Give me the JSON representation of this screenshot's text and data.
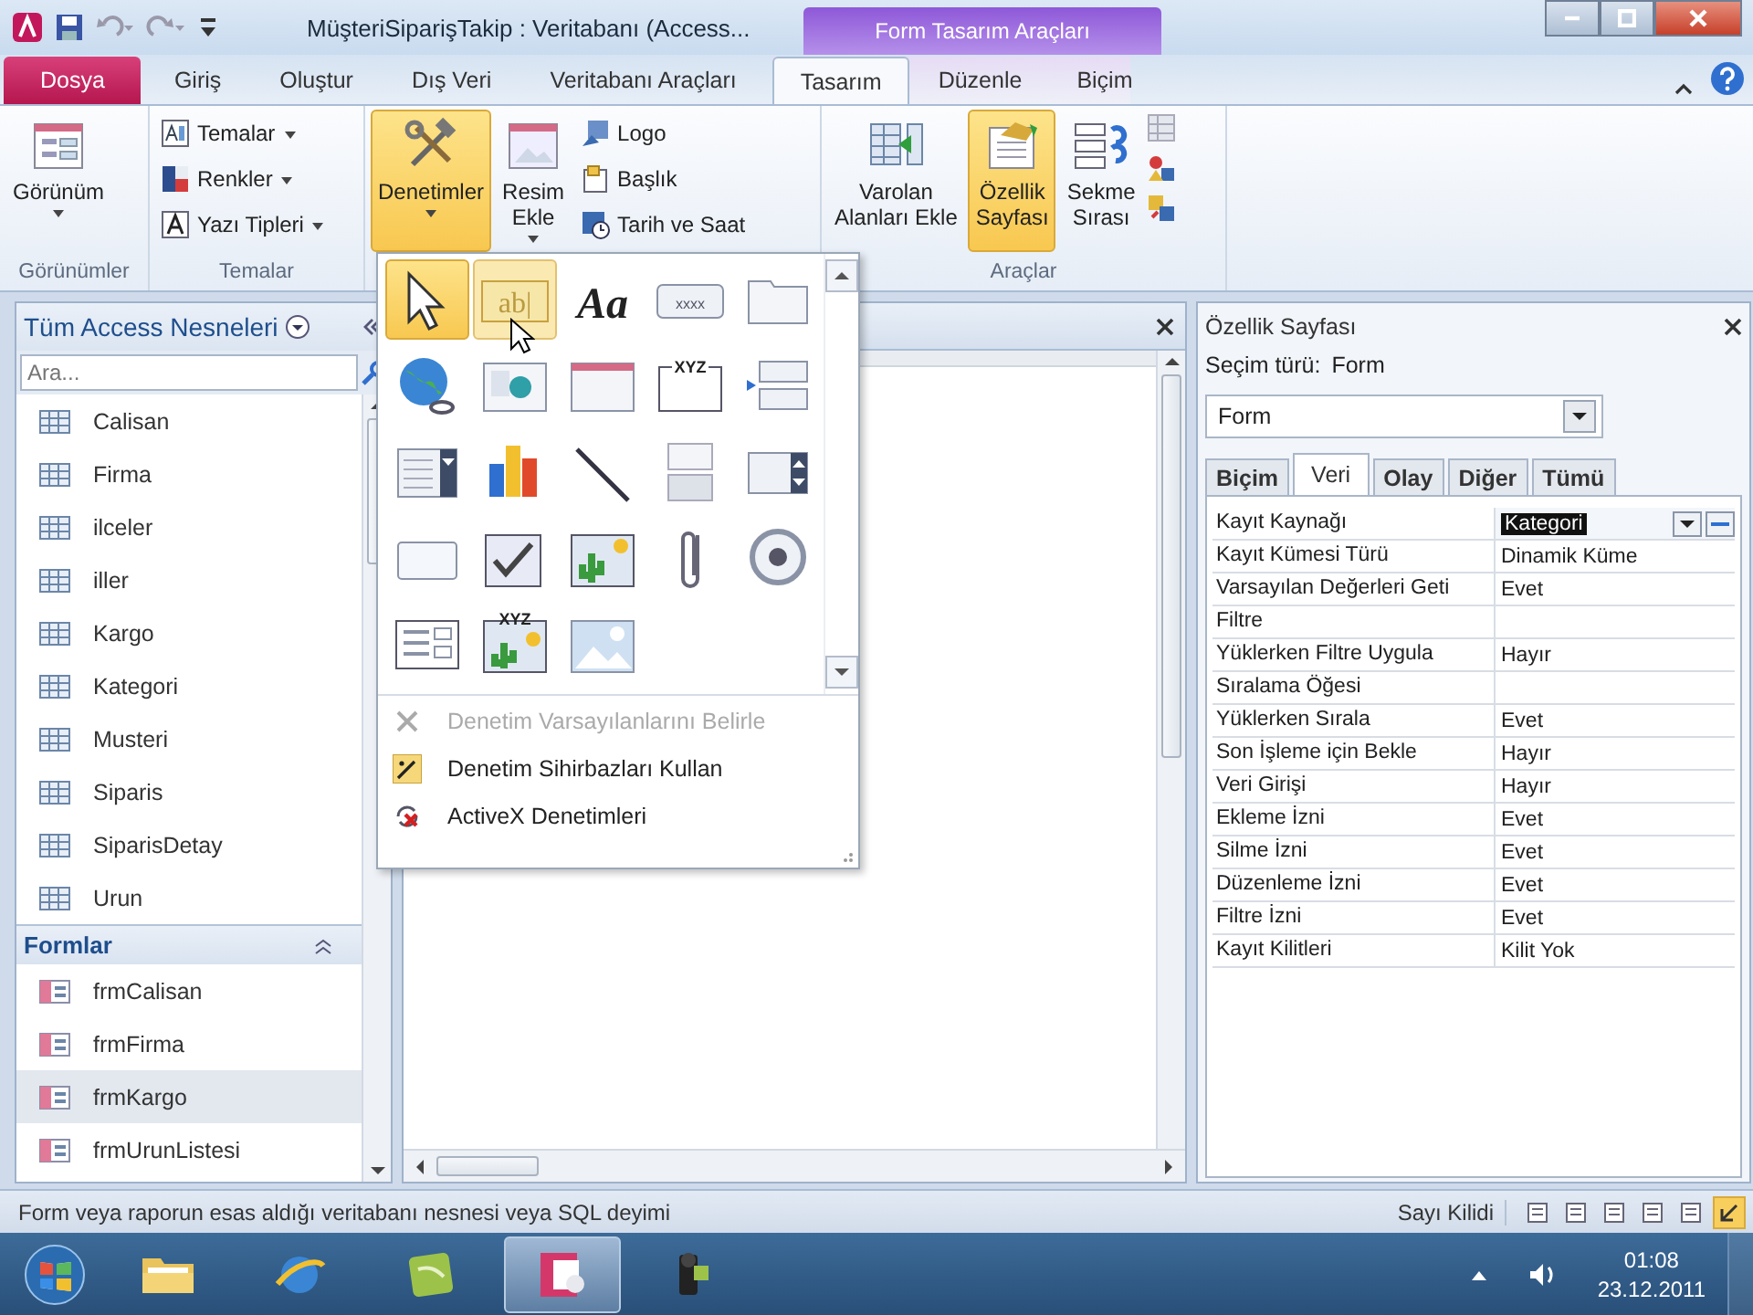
{
  "title_bar": {
    "title": "MüşteriSiparişTakip : Veritabanı (Access...",
    "contextual_group": "Form Tasarım Araçları"
  },
  "ribbon_tabs": [
    {
      "label": "Dosya",
      "kind": "file",
      "selected": false
    },
    {
      "label": "Giriş",
      "kind": "tab",
      "selected": false
    },
    {
      "label": "Oluştur",
      "kind": "tab",
      "selected": false
    },
    {
      "label": "Dış Veri",
      "kind": "tab",
      "selected": false
    },
    {
      "label": "Veritabanı Araçları",
      "kind": "tab",
      "selected": false
    },
    {
      "label": "Tasarım",
      "kind": "contextual",
      "selected": true
    },
    {
      "label": "Düzenle",
      "kind": "contextual",
      "selected": false
    },
    {
      "label": "Biçim",
      "kind": "contextual",
      "selected": false
    }
  ],
  "ribbon_groups": [
    {
      "label": "Görünümler",
      "commands": [
        {
          "label": "Görünüm",
          "kind": "large",
          "dropdown": true,
          "active": false
        }
      ]
    },
    {
      "label": "Temalar",
      "commands": [
        {
          "label": "Temalar",
          "kind": "small",
          "dropdown": true,
          "active": false
        },
        {
          "label": "Renkler",
          "kind": "small",
          "dropdown": true,
          "active": false
        },
        {
          "label": "Yazı Tipleri",
          "kind": "small",
          "dropdown": true,
          "active": false
        }
      ]
    },
    {
      "commands": [
        {
          "label": "Denetimler",
          "kind": "large",
          "dropdown": true,
          "active": true
        },
        {
          "label": "Resim\nEkle",
          "kind": "large",
          "dropdown": true,
          "active": false
        },
        {
          "label": "Logo",
          "kind": "small",
          "dropdown": false,
          "active": false
        },
        {
          "label": "Başlık",
          "kind": "small",
          "dropdown": false,
          "active": false
        },
        {
          "label": "Tarih ve Saat",
          "kind": "small",
          "dropdown": false,
          "active": false
        }
      ]
    },
    {
      "label": "Araçlar",
      "commands": [
        {
          "label": "Varolan\nAlanları Ekle",
          "kind": "large",
          "dropdown": false,
          "active": false
        },
        {
          "label": "Özellik\nSayfası",
          "kind": "large",
          "dropdown": false,
          "active": true
        },
        {
          "label": "Sekme\nSırası",
          "kind": "large",
          "dropdown": false,
          "active": false
        },
        {
          "kind": "icons"
        }
      ]
    }
  ],
  "nav_pane": {
    "title": "Tüm Access Nesneleri",
    "search": {
      "placeholder": "Ara..."
    },
    "tables": [
      {
        "label": "Calisan"
      },
      {
        "label": "Firma"
      },
      {
        "label": "ilceler"
      },
      {
        "label": "iller"
      },
      {
        "label": "Kargo"
      },
      {
        "label": "Kategori"
      },
      {
        "label": "Musteri"
      },
      {
        "label": "Siparis"
      },
      {
        "label": "SiparisDetay"
      },
      {
        "label": "Urun"
      }
    ],
    "forms": {
      "label": "Formlar",
      "items": [
        {
          "label": "frmCalisan",
          "selected": false
        },
        {
          "label": "frmFirma",
          "selected": false
        },
        {
          "label": "frmKargo",
          "selected": true
        },
        {
          "label": "frmUrunListesi",
          "selected": false
        }
      ]
    }
  },
  "controls_gallery": {
    "tools": [
      {
        "kind": "pointer",
        "selected": true,
        "hovered": false
      },
      {
        "kind": "text_box",
        "glyph": "ab|",
        "selected": false,
        "hovered": true
      },
      {
        "kind": "label",
        "glyph": "Aa",
        "selected": false,
        "hovered": false
      },
      {
        "kind": "button",
        "glyph": "xxxx",
        "selected": false,
        "hovered": false
      },
      {
        "kind": "tab_control",
        "selected": false,
        "hovered": false
      },
      {
        "kind": "hyperlink",
        "selected": false,
        "hovered": false
      },
      {
        "kind": "web_browser",
        "selected": false,
        "hovered": false
      },
      {
        "kind": "navigation",
        "selected": false,
        "hovered": false
      },
      {
        "kind": "option_group",
        "glyph": "XYZ",
        "selected": false,
        "hovered": false
      },
      {
        "kind": "page_break",
        "selected": false,
        "hovered": false
      },
      {
        "kind": "combo_box",
        "selected": false,
        "hovered": false
      },
      {
        "kind": "chart",
        "selected": false,
        "hovered": false
      },
      {
        "kind": "line",
        "selected": false,
        "hovered": false
      },
      {
        "kind": "toggle_button",
        "selected": false,
        "hovered": false
      },
      {
        "kind": "list_box",
        "selected": false,
        "hovered": false
      },
      {
        "kind": "rectangle",
        "selected": false,
        "hovered": false
      },
      {
        "kind": "check_box",
        "selected": false,
        "hovered": false
      },
      {
        "kind": "object_frame",
        "selected": false,
        "hovered": false
      },
      {
        "kind": "attachment",
        "selected": false,
        "hovered": false
      },
      {
        "kind": "option_button",
        "selected": false,
        "hovered": false
      },
      {
        "kind": "subform",
        "selected": false,
        "hovered": false
      },
      {
        "kind": "bound_object_frame",
        "glyph": "XYZ",
        "selected": false,
        "hovered": false
      },
      {
        "kind": "image",
        "selected": false,
        "hovered": false
      }
    ],
    "menu": [
      {
        "label": "Denetim Varsayılanlarını Belirle",
        "disabled": true
      },
      {
        "label": "Denetim Sihirbazları Kullan",
        "disabled": false
      },
      {
        "label": "ActiveX Denetimleri",
        "disabled": false
      }
    ]
  },
  "property_sheet": {
    "title": "Özellik Sayfası",
    "selection_label": "Seçim türü:",
    "selection_type": "Form",
    "object": "Form",
    "tabs": [
      {
        "label": "Biçim",
        "selected": false
      },
      {
        "label": "Veri",
        "selected": true
      },
      {
        "label": "Olay",
        "selected": false
      },
      {
        "label": "Diğer",
        "selected": false
      },
      {
        "label": "Tümü",
        "selected": false
      }
    ],
    "properties": [
      {
        "name": "Kayıt Kaynağı",
        "value": "Kategori",
        "selected": true
      },
      {
        "name": "Kayıt Kümesi Türü",
        "value": "Dinamik Küme",
        "selected": false
      },
      {
        "name": "Varsayılan Değerleri Geti",
        "value": "Evet",
        "selected": false
      },
      {
        "name": "Filtre",
        "selected": false
      },
      {
        "name": "Yüklerken Filtre Uygula",
        "value": "Hayır",
        "selected": false
      },
      {
        "name": "Sıralama Öğesi",
        "selected": false
      },
      {
        "name": "Yüklerken Sırala",
        "value": "Evet",
        "selected": false
      },
      {
        "name": "Son İşleme için Bekle",
        "value": "Hayır",
        "selected": false
      },
      {
        "name": "Veri Girişi",
        "value": "Hayır",
        "selected": false
      },
      {
        "name": "Ekleme İzni",
        "value": "Evet",
        "selected": false
      },
      {
        "name": "Silme İzni",
        "value": "Evet",
        "selected": false
      },
      {
        "name": "Düzenleme İzni",
        "value": "Evet",
        "selected": false
      },
      {
        "name": "Filtre İzni",
        "value": "Evet",
        "selected": false
      },
      {
        "name": "Kayıt Kilitleri",
        "value": "Kilit Yok",
        "selected": false
      }
    ]
  },
  "status_bar": {
    "message": "Form veya raporun esas aldığı veritabanı nesnesi veya SQL deyimi",
    "indicator": "Sayı Kilidi",
    "views": [
      {
        "selected": false
      },
      {
        "selected": false
      },
      {
        "selected": false
      },
      {
        "selected": false
      },
      {
        "selected": false
      },
      {
        "selected": true
      }
    ]
  },
  "taskbar": {
    "apps": [
      {
        "kind": "folder",
        "active": false
      },
      {
        "kind": "browser",
        "active": false
      },
      {
        "kind": "green",
        "active": false
      },
      {
        "kind": "access",
        "active": true
      },
      {
        "kind": "camera",
        "active": false
      }
    ],
    "time": "01:08",
    "date": "23.12.2011"
  }
}
